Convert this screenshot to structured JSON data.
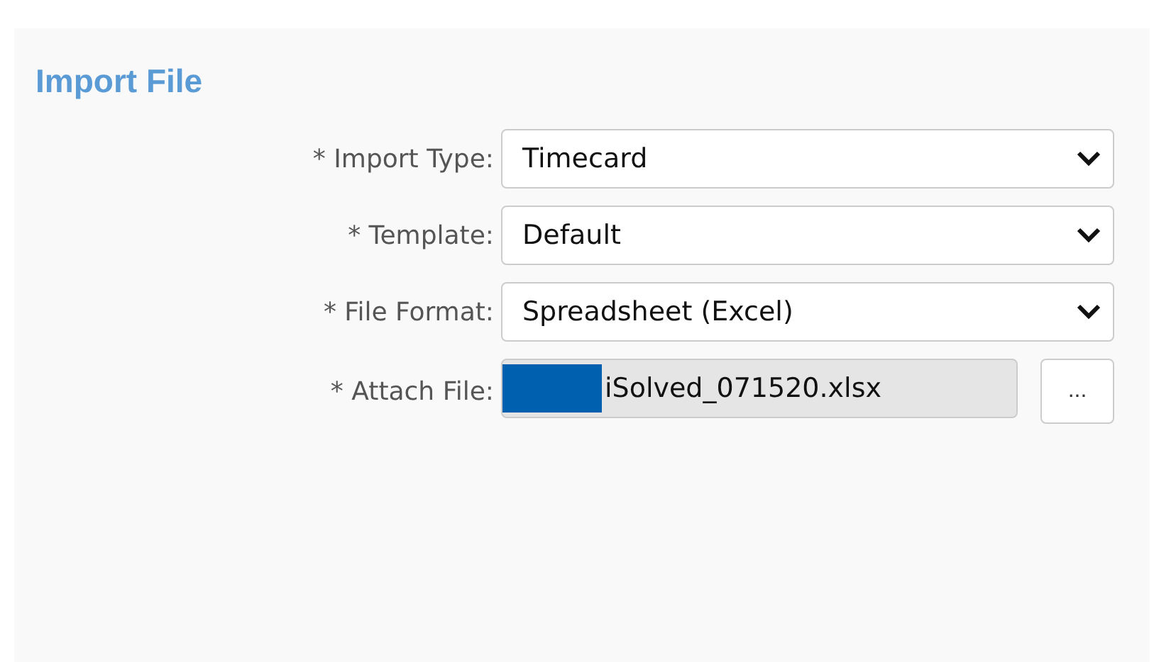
{
  "panel": {
    "title": "Import File"
  },
  "fields": [
    {
      "kind": "select",
      "label": "* Import Type:",
      "value": "Timecard"
    },
    {
      "kind": "select",
      "label": "* Template:",
      "value": "Default"
    },
    {
      "kind": "select",
      "label": "* File Format:",
      "value": "Spreadsheet (Excel)"
    },
    {
      "kind": "file",
      "label": "* Attach File:",
      "value": "iSolved_071520.xlsx",
      "redacted": true,
      "button": "..."
    }
  ]
}
